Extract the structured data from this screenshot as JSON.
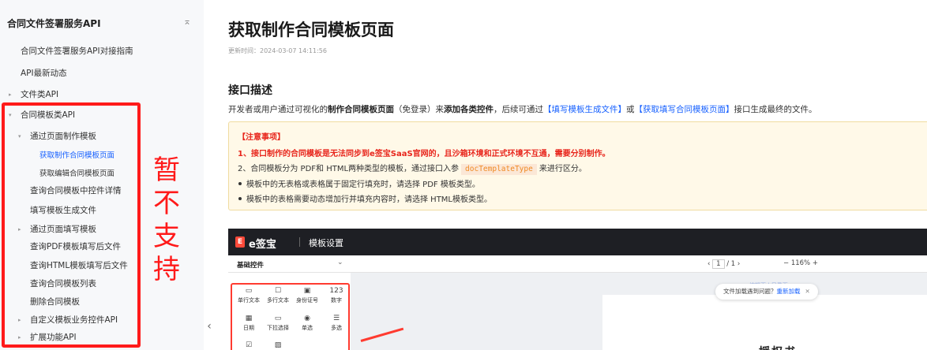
{
  "sidebar": {
    "title": "合同文件签署服务API",
    "collapse_icon": "collapse-icon",
    "items": [
      {
        "label": "合同文件签署服务API对接指南"
      },
      {
        "label": "API最新动态"
      },
      {
        "label": "文件类API"
      },
      {
        "label": "合同模板类API"
      },
      {
        "label": "通过页面制作模板"
      },
      {
        "label": "获取制作合同模板页面"
      },
      {
        "label": "获取编辑合同模板页面"
      },
      {
        "label": "查询合同模板中控件详情"
      },
      {
        "label": "填写模板生成文件"
      },
      {
        "label": "通过页面填写模板"
      },
      {
        "label": "查询PDF模板填写后文件"
      },
      {
        "label": "查询HTML模板填写后文件"
      },
      {
        "label": "查询合同模板列表"
      },
      {
        "label": "删除合同模板"
      },
      {
        "label": "自定义模板业务控件API"
      },
      {
        "label": "扩展功能API"
      }
    ],
    "annotation": [
      "暂",
      "不",
      "支",
      "持"
    ],
    "annotation_color": "#ff1a1a"
  },
  "main": {
    "title": "获取制作合同模板页面",
    "updated": "更新时间：2024-03-07 14:11:56",
    "section_title": "接口描述",
    "desc": {
      "p1": "开发者或用户通过可视化的",
      "b1": "制作合同模板页面",
      "p2": "（免登录）来",
      "b2": "添加各类控件",
      "p3": "，后续可通过",
      "link1": "【填写模板生成文件】",
      "p4": "或",
      "link2": "【获取填写合同模板页面】",
      "p5": "接口生成最终的文件。"
    },
    "notice": {
      "heading": "【注意事项】",
      "line1": "1、接口制作的合同模板是无法同步到e签宝SaaS官网的，且沙箱环境和正式环境不互通，需要分别制作。",
      "line2_a": "2、合同模板分为 PDF和 HTML两种类型的模板，通过接口入参",
      "line2_code": "docTemplateType",
      "line2_b": "来进行区分。",
      "bullet1": "模板中的无表格或表格属于固定行填充时，请选择 PDF 模板类型。",
      "bullet2": "模板中的表格需要动态增加行并填充内容时，请选择 HTML模板类型。"
    }
  },
  "preview": {
    "brand": "e签宝",
    "logo_mark": "E",
    "bar_title": "模板设置",
    "basic_controls": "基础控件",
    "page_current": "1",
    "page_total": "/ 1",
    "zoom": "116%",
    "controls": [
      {
        "label": "单行文本",
        "icon": "▭"
      },
      {
        "label": "多行文本",
        "icon": "☐"
      },
      {
        "label": "身份证号",
        "icon": "▣"
      },
      {
        "label": "数字",
        "icon": "123"
      },
      {
        "label": "日期",
        "icon": "▦"
      },
      {
        "label": "下拉选择",
        "icon": "▭"
      },
      {
        "label": "单选",
        "icon": "◉"
      },
      {
        "label": "多选",
        "icon": "☰"
      },
      {
        "label": "",
        "icon": "☑"
      },
      {
        "label": "",
        "icon": "▨"
      }
    ],
    "toast_text": "文件加载遇到问题？",
    "toast_link": "重新加载",
    "faint_text": "编辑页 | 目录页",
    "doc_heading": "授权书"
  }
}
